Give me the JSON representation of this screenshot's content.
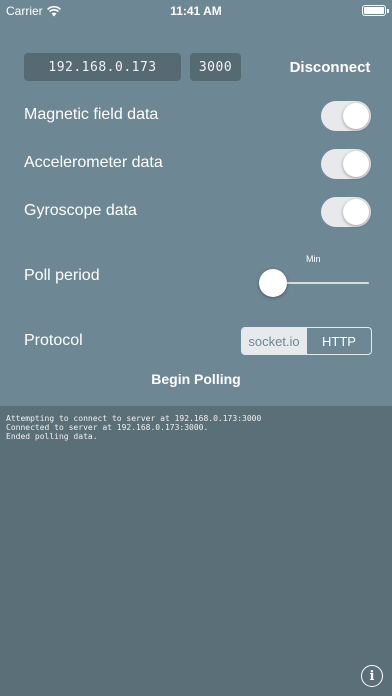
{
  "status_bar": {
    "carrier": "Carrier",
    "time": "11:41 AM",
    "icons": [
      "wifi-icon",
      "battery-icon"
    ]
  },
  "connection": {
    "ip": "192.168.0.173",
    "port": "3000",
    "disconnect_label": "Disconnect"
  },
  "toggles": [
    {
      "label": "Magnetic field data",
      "on": true
    },
    {
      "label": "Accelerometer data",
      "on": true
    },
    {
      "label": "Gyroscope data",
      "on": true
    }
  ],
  "poll": {
    "label": "Poll period",
    "min_label": "Min",
    "value_fraction": 0
  },
  "protocol": {
    "label": "Protocol",
    "options": [
      "socket.io",
      "HTTP"
    ],
    "selected": "socket.io"
  },
  "begin_polling_label": "Begin Polling",
  "log": [
    "Attempting to connect to server at 192.168.0.173:3000",
    "Connected to server at 192.168.0.173:3000.",
    "Ended polling data."
  ],
  "info_icon": "info-icon",
  "info_glyph": "i",
  "colors": {
    "panel": "#6d8794",
    "log_background": "#5b6f79",
    "field_background": "#566a74",
    "toggle_on": "#e7e9ea"
  }
}
